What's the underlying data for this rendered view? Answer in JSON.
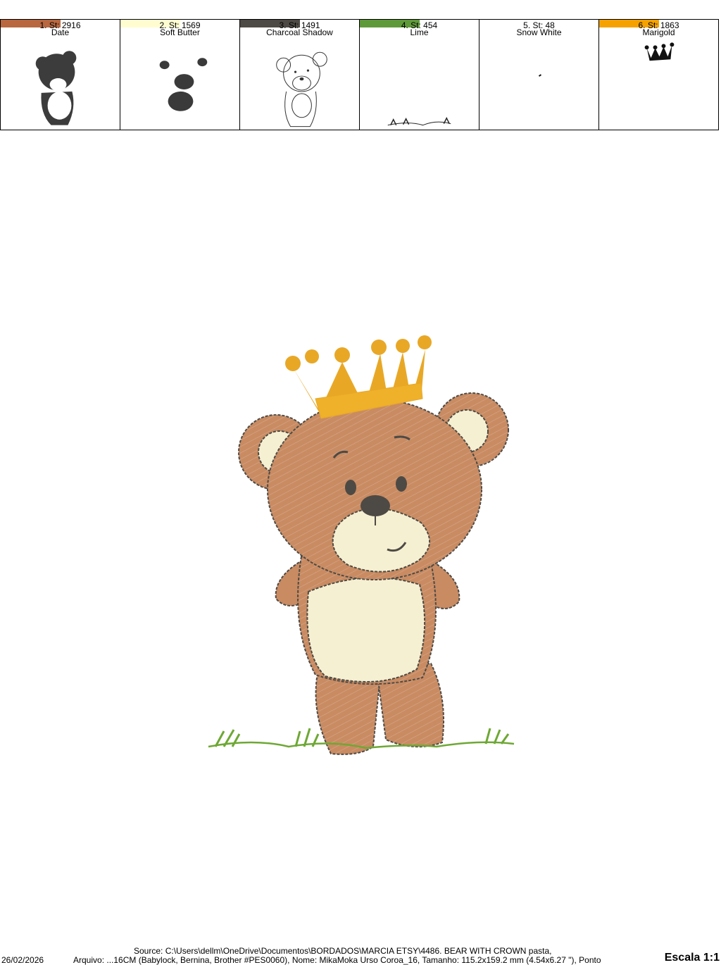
{
  "palette": {
    "colors": [
      {
        "index_label": "1. St: 2916",
        "name": "Date",
        "hex": "#b8673f"
      },
      {
        "index_label": "2. St: 1569",
        "name": "Soft Butter",
        "hex": "#fffdd0"
      },
      {
        "index_label": "3. St: 1491",
        "name": "Charcoal Shadow",
        "hex": "#4d4a45"
      },
      {
        "index_label": "4. St: 454",
        "name": "Lime",
        "hex": "#5f9a3a"
      },
      {
        "index_label": "5. St: 48",
        "name": "Snow White",
        "hex": "#ffffff"
      },
      {
        "index_label": "6. St: 1863",
        "name": "Marigold",
        "hex": "#f5a200"
      }
    ]
  },
  "design": {
    "fur_color": "#c98b62",
    "belly_color": "#f6f0d2",
    "outline_color": "#4d4a45",
    "crown_color": "#e8a826",
    "grass_color": "#6ea834"
  },
  "footer": {
    "source": "Source: C:\\Users\\dellm\\OneDrive\\Documentos\\BORDADOS\\MARCIA ETSY\\4486. BEAR WITH CROWN pasta,",
    "date": "26/02/2026",
    "arquivo": "Arquivo: ...16CM (Babylock, Bernina, Brother #PES0060), Nome: MikaMoka Urso Coroa_16, Tamanho: 115.2x159.2 mm (4.54x6.27 \"), Ponto",
    "scale": "Escala 1:1"
  }
}
